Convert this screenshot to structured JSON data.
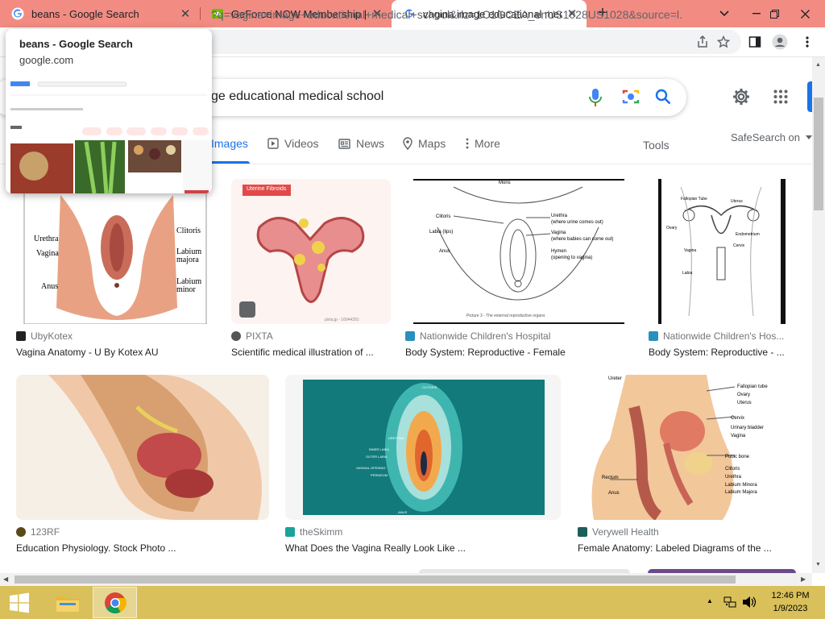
{
  "browser": {
    "tabs": [
      {
        "title": "beans - Google Search",
        "favicon": "google-icon"
      },
      {
        "title": "GeForce NOW Membership | NVI",
        "favicon": "nvidia-icon"
      },
      {
        "title": "vagina image educational medical school",
        "favicon": "google-icon"
      }
    ],
    "new_tab": "+",
    "url": "?q=vagina+image+educational+medical+school&rlz=1C1GCEA_enUS1028US1028&source=l..."
  },
  "hover_card": {
    "title": "beans - Google Search",
    "domain": "google.com"
  },
  "search": {
    "query": "ge educational medical school",
    "safesearch": "SafeSearch on"
  },
  "nav": {
    "images": "Images",
    "videos": "Videos",
    "news": "News",
    "maps": "Maps",
    "more": "More",
    "tools": "Tools"
  },
  "results": [
    {
      "source": "UbyKotex",
      "caption": "Vagina Anatomy - U By Kotex AU",
      "src_color": "#222222"
    },
    {
      "source": "PIXTA",
      "caption": "Scientific medical illustration of ...",
      "src_color": "#555555"
    },
    {
      "source": "Nationwide Children's Hospital",
      "caption": "Body System: Reproductive - Female",
      "src_color": "#2a8fbd"
    },
    {
      "source": "Nationwide Children's Hos...",
      "caption": "Body System: Reproductive - ...",
      "src_color": "#2a8fbd"
    },
    {
      "source": "123RF",
      "caption": "Education Physiology. Stock Photo ...",
      "src_color": "#5a4a1a"
    },
    {
      "source": "theSkimm",
      "caption": "What Does the Vagina Really Look Like ...",
      "src_color": "#1aa39a"
    },
    {
      "source": "Verywell Health",
      "caption": "Female Anatomy: Labeled Diagrams of the ...",
      "src_color": "#1b5e5a"
    }
  ],
  "image_labels": {
    "kotex": [
      "Urethra",
      "Vagina",
      "Anus",
      "Clitoris",
      "Labium majora",
      "Labium minor"
    ],
    "pixta_title": "Uterine Fibroids",
    "pixta_watermark": "pixta.jp - 16044291",
    "nch1": {
      "top": "Mons",
      "left": [
        "Clitoris",
        "Labia (lips)",
        "Anus"
      ],
      "right": [
        "Urethra",
        "(where urine comes out)",
        "Vagina",
        "(where babies can come out)",
        "Hymen",
        "(opening to vagina)"
      ],
      "footer": "Picture 3 - The external reproductive organs"
    },
    "nch2": {
      "labels": [
        "Fallopian Tube",
        "Uterus",
        "Ovary",
        "Endometrium",
        "Cervix",
        "Vagina",
        "Labia"
      ]
    },
    "skimm": [
      "CLITORIS",
      "URETHRA",
      "INNER LABIA",
      "OUTER LABIA",
      "VAGINAL OPENING",
      "PERINEUM",
      "ANUS"
    ],
    "verywell": [
      "Ureter",
      "Fallopian tube",
      "Ovary",
      "Uterus",
      "Cervix",
      "Urinary bladder",
      "Vagina",
      "Pubic bone",
      "Clitoris",
      "Urethra",
      "Labium Minora",
      "Labium Majora",
      "Rectum",
      "Anus"
    ]
  },
  "taskbar": {
    "time": "12:46 PM",
    "date": "1/9/2023"
  },
  "colors": {
    "tabbar": "#f28c83",
    "taskbar": "#d9c05a",
    "accent": "#1a73e8"
  }
}
